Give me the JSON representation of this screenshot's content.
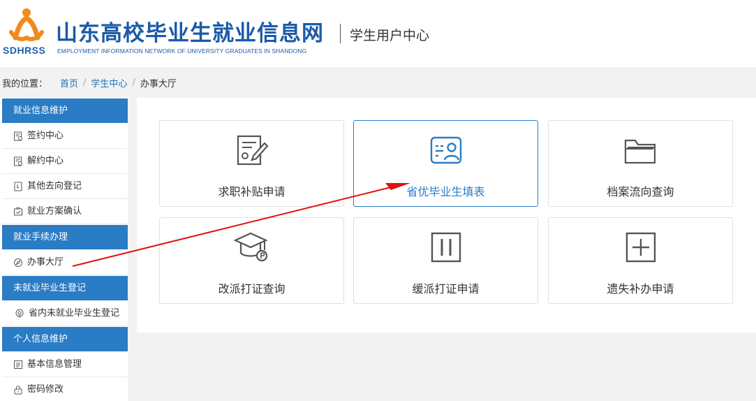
{
  "header": {
    "logo_abbr": "SDHRSS",
    "site_title": "山东高校毕业生就业信息网",
    "site_subtitle": "EMPLOYMENT INFORMATION NETWORK OF UNIVERSITY GRADUATES IN SHANDONG",
    "section": "学生用户中心"
  },
  "breadcrumb": {
    "label": "我的位置：",
    "items": [
      "首页",
      "学生中心",
      "办事大厅"
    ]
  },
  "sidebar": {
    "groups": [
      {
        "title": "就业信息维护",
        "items": [
          {
            "label": "签约中心",
            "icon": "contract-icon"
          },
          {
            "label": "解约中心",
            "icon": "cancel-contract-icon"
          },
          {
            "label": "其他去向登记",
            "icon": "register-icon"
          },
          {
            "label": "就业方案确认",
            "icon": "confirm-icon"
          }
        ]
      },
      {
        "title": "就业手续办理",
        "items": [
          {
            "label": "办事大厅",
            "icon": "compass-icon"
          }
        ]
      },
      {
        "title": "未就业毕业生登记",
        "items": [
          {
            "label": "省内未就业毕业生登记",
            "icon": "location-icon"
          }
        ]
      },
      {
        "title": "个人信息维护",
        "items": [
          {
            "label": "基本信息管理",
            "icon": "profile-icon"
          },
          {
            "label": "密码修改",
            "icon": "lock-icon"
          }
        ]
      }
    ]
  },
  "cards": [
    {
      "label": "求职补贴申请",
      "icon": "document-edit-icon"
    },
    {
      "label": "省优毕业生填表",
      "icon": "id-card-icon"
    },
    {
      "label": "档案流向查询",
      "icon": "folder-icon"
    },
    {
      "label": "改派打证查询",
      "icon": "graduation-cap-icon"
    },
    {
      "label": "缓派打证申请",
      "icon": "pause-icon"
    },
    {
      "label": "遗失补办申请",
      "icon": "plus-box-icon"
    }
  ],
  "colors": {
    "brand": "#1a5aa8",
    "accent": "#2a7cc4",
    "logo_orange": "#f08a1c",
    "annotation_arrow": "#e01010"
  }
}
